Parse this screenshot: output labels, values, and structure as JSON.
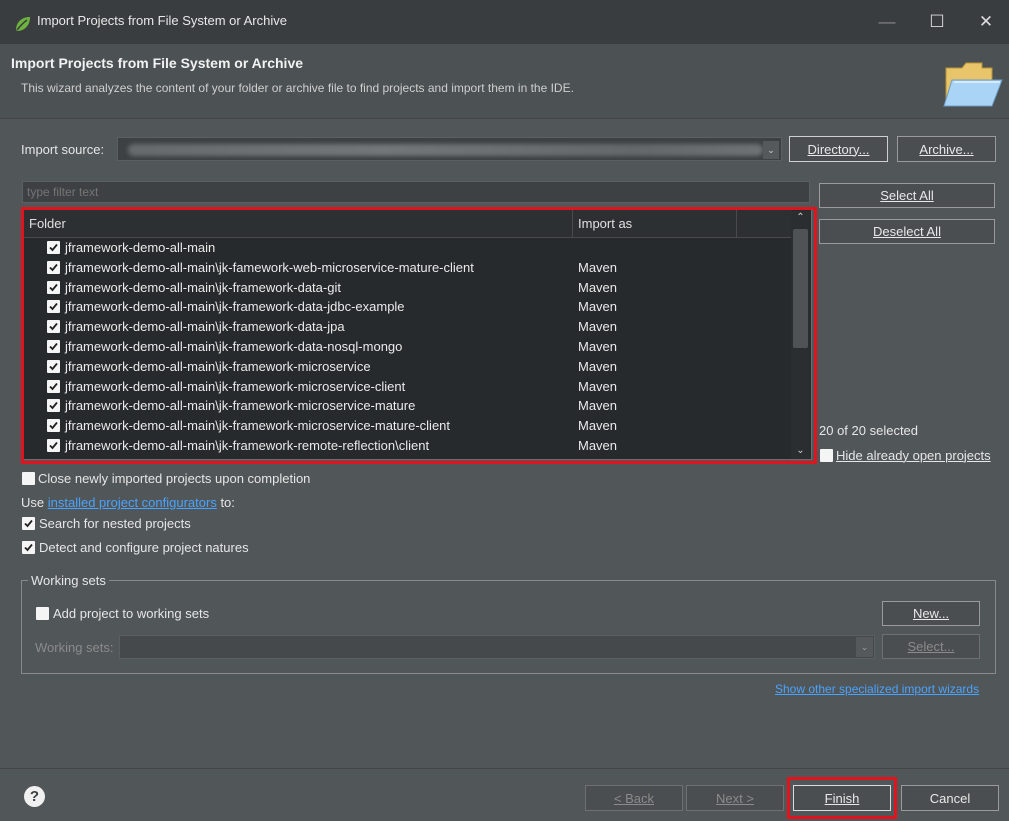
{
  "window": {
    "title": "Import Projects from File System or Archive",
    "controls": [
      "—",
      "☐",
      "✕"
    ]
  },
  "header": {
    "title": "Import Projects from File System or Archive",
    "description": "This wizard analyzes the content of your folder or archive file to find projects and import them in the IDE."
  },
  "import_source": {
    "label": "Import source:",
    "directory_button": "Directory...",
    "archive_button": "Archive..."
  },
  "filter": {
    "placeholder": "type filter text"
  },
  "side_buttons": {
    "select_all": "Select All",
    "deselect_all": "Deselect All"
  },
  "table": {
    "columns": [
      "Folder",
      "Import as"
    ],
    "rows": [
      {
        "folder": "jframework-demo-all-main",
        "import_as": ""
      },
      {
        "folder": "jframework-demo-all-main\\jk-famework-web-microservice-mature-client",
        "import_as": "Maven"
      },
      {
        "folder": "jframework-demo-all-main\\jk-framework-data-git",
        "import_as": "Maven"
      },
      {
        "folder": "jframework-demo-all-main\\jk-framework-data-jdbc-example",
        "import_as": "Maven"
      },
      {
        "folder": "jframework-demo-all-main\\jk-framework-data-jpa",
        "import_as": "Maven"
      },
      {
        "folder": "jframework-demo-all-main\\jk-framework-data-nosql-mongo",
        "import_as": "Maven"
      },
      {
        "folder": "jframework-demo-all-main\\jk-framework-microservice",
        "import_as": "Maven"
      },
      {
        "folder": "jframework-demo-all-main\\jk-framework-microservice-client",
        "import_as": "Maven"
      },
      {
        "folder": "jframework-demo-all-main\\jk-framework-microservice-mature",
        "import_as": "Maven"
      },
      {
        "folder": "jframework-demo-all-main\\jk-framework-microservice-mature-client",
        "import_as": "Maven"
      },
      {
        "folder": "jframework-demo-all-main\\jk-framework-remote-reflection\\client",
        "import_as": "Maven"
      }
    ]
  },
  "selection_count": "20 of 20 selected",
  "hide_open": "Hide already open projects",
  "options": {
    "close_projects": "Close newly imported projects upon completion",
    "use_prefix": "Use ",
    "configurators_link": "installed project configurators",
    "use_suffix": " to:",
    "search_nested": "Search for nested projects",
    "detect_natures": "Detect and configure project natures"
  },
  "working_sets": {
    "legend": "Working sets",
    "add_label": "Add project to working sets",
    "new_button": "New...",
    "sets_label": "Working sets:",
    "select_button": "Select..."
  },
  "other_wizards_link": "Show other specialized import wizards",
  "footer": {
    "help": "?",
    "back": "< Back",
    "next": "Next >",
    "finish": "Finish",
    "cancel": "Cancel"
  }
}
